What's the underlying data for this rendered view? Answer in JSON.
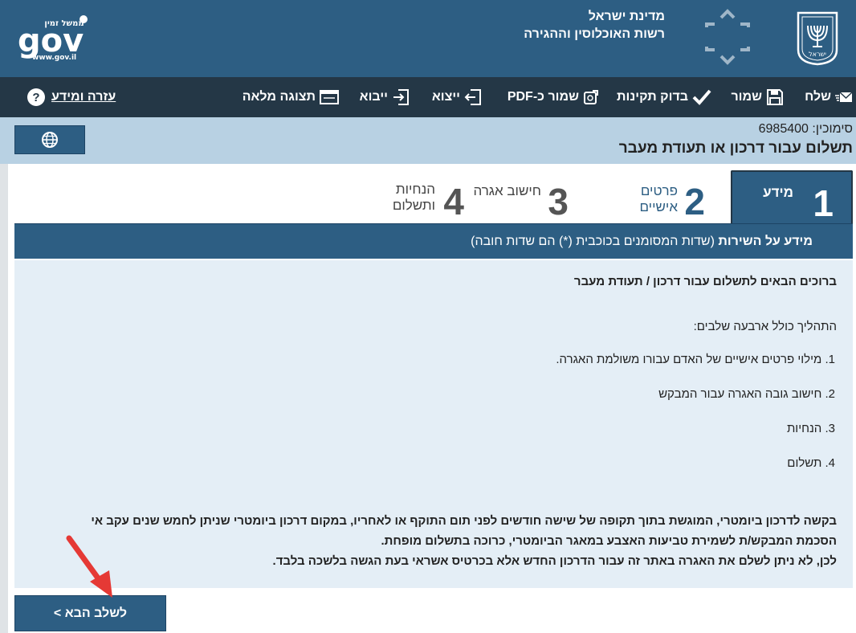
{
  "header": {
    "ministry_line1": "מדינת ישראל",
    "ministry_line2": "רשות האוכלוסין וההגירה",
    "gov_small": "ממשל זמין",
    "gov_logo": "gov",
    "gov_url": "www.gov.il",
    "emblem_text": "ישראל"
  },
  "toolbar": {
    "send": "שלח",
    "save": "שמור",
    "validate": "בדוק תקינות",
    "save_pdf": "שמור כ-PDF",
    "export": "ייצוא",
    "import": "ייבוא",
    "fullscreen": "תצוגה מלאה",
    "help": "עזרה ומידע",
    "help_glyph": "?"
  },
  "band": {
    "reference": "סימוכין: 6985400",
    "title": "תשלום עבור דרכון או תעודת מעבר"
  },
  "steps": [
    {
      "num": "1",
      "label": "מידע"
    },
    {
      "num": "2",
      "label_line1": "פרטים",
      "label_line2": "אישיים"
    },
    {
      "num": "3",
      "label": "חישוב אגרה"
    },
    {
      "num": "4",
      "label_line1": "הנחיות",
      "label_line2": "ותשלום"
    }
  ],
  "section": {
    "title": "מידע על השירות",
    "note": " (שדות המסומנים בכוכבית (*) הם שדות חובה)"
  },
  "content": {
    "heading": "ברוכים הבאים לתשלום עבור דרכון / תעודת מעבר",
    "intro": "התהליך כולל ארבעה שלבים:",
    "items": [
      "1. מילוי פרטים אישיים של האדם עבורו משולמת האגרה.",
      "2. חישוב גובה האגרה עבור המבקש",
      "3. הנחיות",
      "4. תשלום"
    ],
    "para_line1": "בקשה לדרכון ביומטרי, המוגשת בתוך תקופה של שישה חודשים לפני תום התוקף או לאחריו, במקום דרכון ביומטרי שניתן לחמש שנים עקב אי",
    "para_line2": "הסכמת המבקש/ת לשמירת טביעות האצבע במאגר הביומטרי, כרוכה בתשלום מופחת.",
    "para_line3": "לכן, לא ניתן לשלם את האגרה באתר זה עבור הדרכון החדש אלא בכרטיס אשראי בעת הגשה בלשכה בלבד."
  },
  "next_button": "לשלב הבא >",
  "colors": {
    "header": "#2d5e83",
    "toolbar": "#243746",
    "band": "#b8d1e3",
    "content_bg": "#e4eef6",
    "annotation_arrow": "#e53935"
  }
}
